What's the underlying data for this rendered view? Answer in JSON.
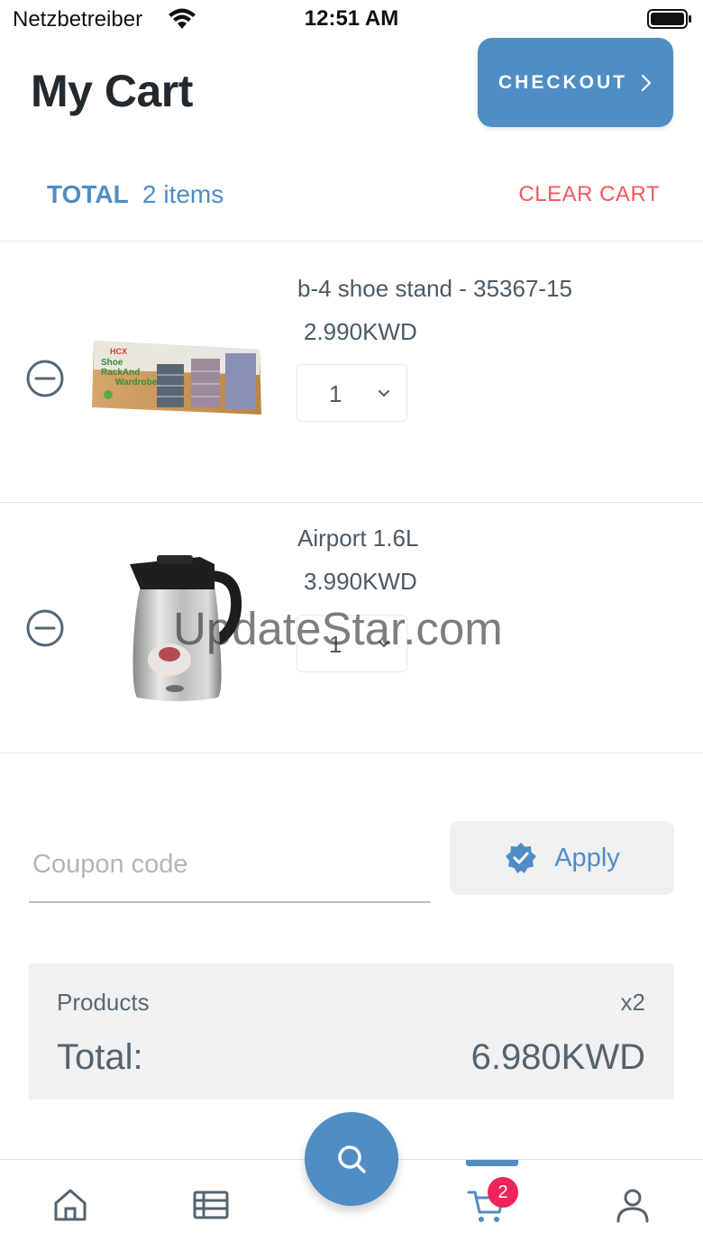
{
  "status_bar": {
    "carrier": "Netzbetreiber",
    "time": "12:51 AM"
  },
  "header": {
    "title": "My Cart",
    "checkout_label": "CHECKOUT"
  },
  "summary": {
    "total_label": "TOTAL",
    "items_count": "2 items",
    "clear_cart_label": "CLEAR CART"
  },
  "cart_items": [
    {
      "name": "b-4 shoe stand - 35367-15",
      "price": "2.990KWD",
      "quantity": "1",
      "image_text": "HCX Shoe RackAnd Wardrobe"
    },
    {
      "name": "Airport 1.6L",
      "price": "3.990KWD",
      "quantity": "1"
    }
  ],
  "coupon": {
    "placeholder": "Coupon code",
    "value": "",
    "apply_label": "Apply"
  },
  "totals": {
    "products_label": "Products",
    "products_count": "x2",
    "total_label": "Total:",
    "total_value": "6.980KWD"
  },
  "watermark": "UpdateStar.com",
  "bottom_nav": {
    "items": [
      "home-icon",
      "list-icon",
      "search-icon",
      "cart-icon",
      "user-icon"
    ],
    "active": "cart-icon",
    "cart_badge": "2"
  },
  "colors": {
    "accent": "#4f8dc4",
    "danger": "#ee5a5f",
    "badge": "#f0245c"
  }
}
